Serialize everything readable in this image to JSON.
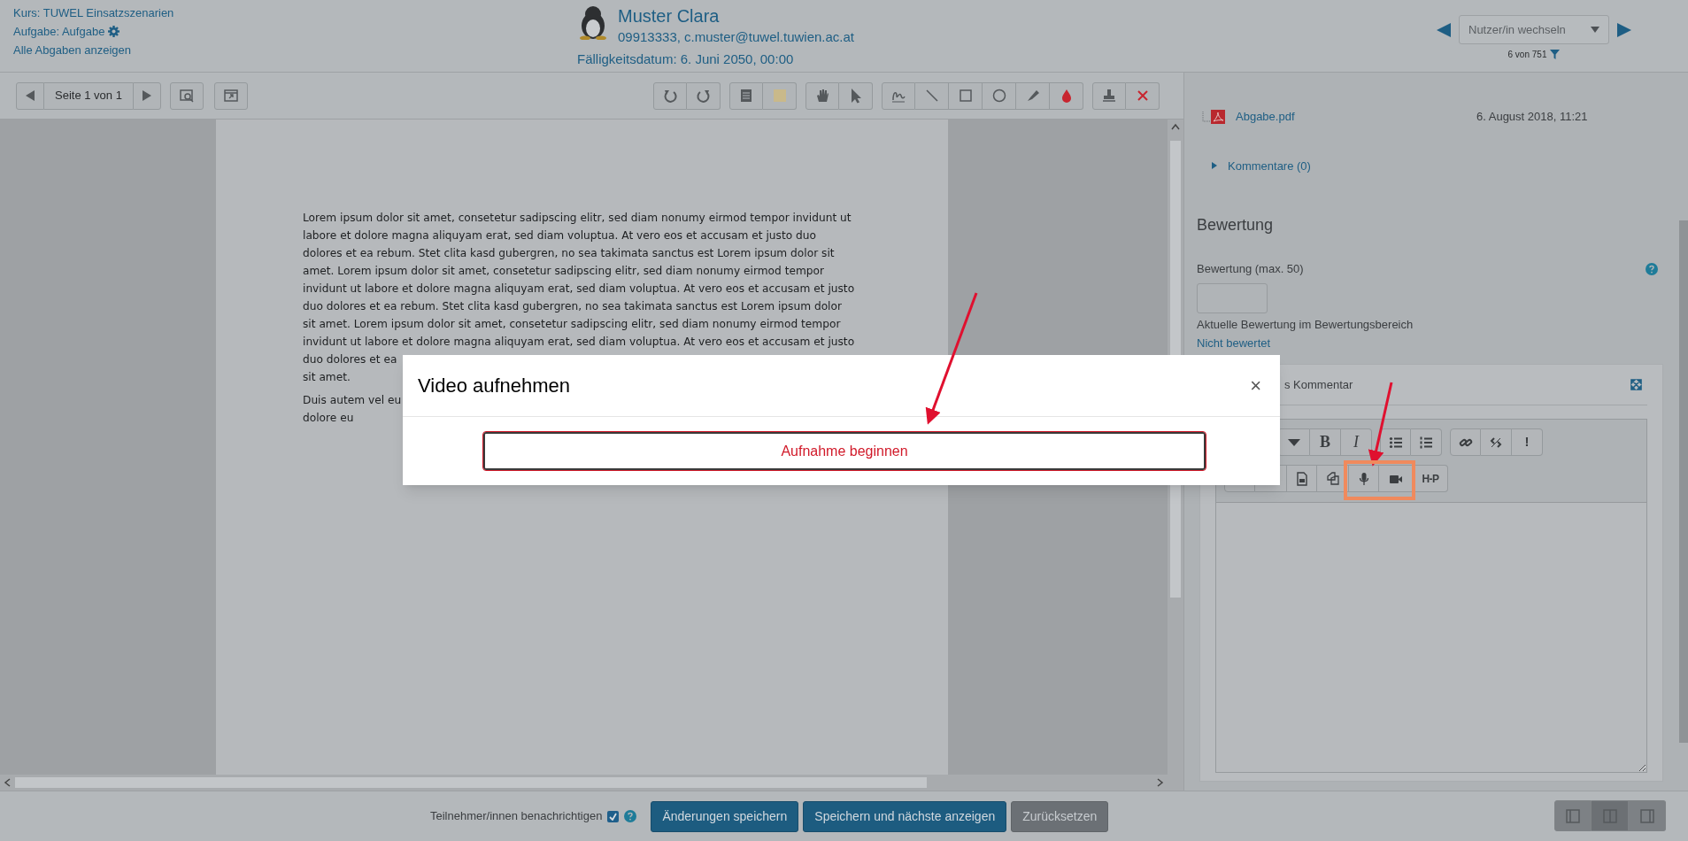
{
  "header": {
    "course": "Kurs: TUWEL Einsatzszenarien",
    "assignment": "Aufgabe: Aufgabe",
    "all_submissions": "Alle Abgaben anzeigen",
    "user_name": "Muster Clara",
    "user_info": "09913333, c.muster@tuwel.tuwien.ac.at",
    "due_date": "Fälligkeitsdatum: 6. Juni 2050, 00:00",
    "user_select": {
      "placeholder": "Nutzer/in wechseln"
    },
    "user_count": "6 von 751"
  },
  "pdf_toolbar": {
    "page_label": "Seite 1 von 1"
  },
  "document": {
    "paragraphs": [
      [
        "Lorem ipsum dolor sit amet, consetetur sadipscing elitr, sed diam nonumy eirmod tempor invidunt ut",
        "labore et dolore magna aliquyam erat, sed diam voluptua. At vero eos et accusam et justo duo",
        "dolores et ea rebum. Stet clita kasd gubergren, no sea takimata sanctus est Lorem ipsum dolor sit",
        "amet. Lorem ipsum dolor sit amet, consetetur sadipscing elitr, sed diam nonumy eirmod tempor",
        "invidunt ut labore et dolore magna aliquyam erat, sed diam voluptua. At vero eos et accusam et justo",
        "duo dolores et ea rebum. Stet clita kasd gubergren, no sea takimata sanctus est Lorem ipsum dolor",
        "sit amet. Lorem ipsum dolor sit amet, consetetur sadipscing elitr, sed diam nonumy eirmod tempor",
        "invidunt ut labore et dolore magna aliquyam erat, sed diam voluptua. At vero eos et accusam et justo",
        "duo dolores et ea",
        "sit amet."
      ],
      [
        "Duis autem vel eu",
        "dolore eu"
      ]
    ]
  },
  "submission": {
    "file": "Abgabe.pdf",
    "date": "6. August 2018, 11:21",
    "comments": {
      "label": "Kommentare (0)",
      "expanded": false
    }
  },
  "grading": {
    "heading": "Bewertung",
    "label": "Bewertung (max. 50)",
    "hint": "Aktuelle Bewertung im Bewertungsbereich",
    "current": "Nicht bewertet"
  },
  "feedback": {
    "title": "s Kommentar",
    "bold_label": "B",
    "italic_label": "I",
    "important_label": "!",
    "h5p_label": "H-P"
  },
  "footer": {
    "notify": {
      "label": "Teilnehmer/innen benachrichtigen",
      "checked": true
    },
    "buttons": [
      {
        "label": "Änderungen speichern",
        "kind": "primary"
      },
      {
        "label": "Speichern und nächste anzeigen",
        "kind": "primary"
      },
      {
        "label": "Zurücksetzen",
        "kind": "secondary"
      }
    ],
    "layout_modes": [
      {
        "selected": false
      },
      {
        "selected": true
      },
      {
        "selected": false
      }
    ]
  },
  "modal": {
    "title": "Video aufnehmen",
    "close": "×",
    "action": "Aufnahme beginnen"
  }
}
